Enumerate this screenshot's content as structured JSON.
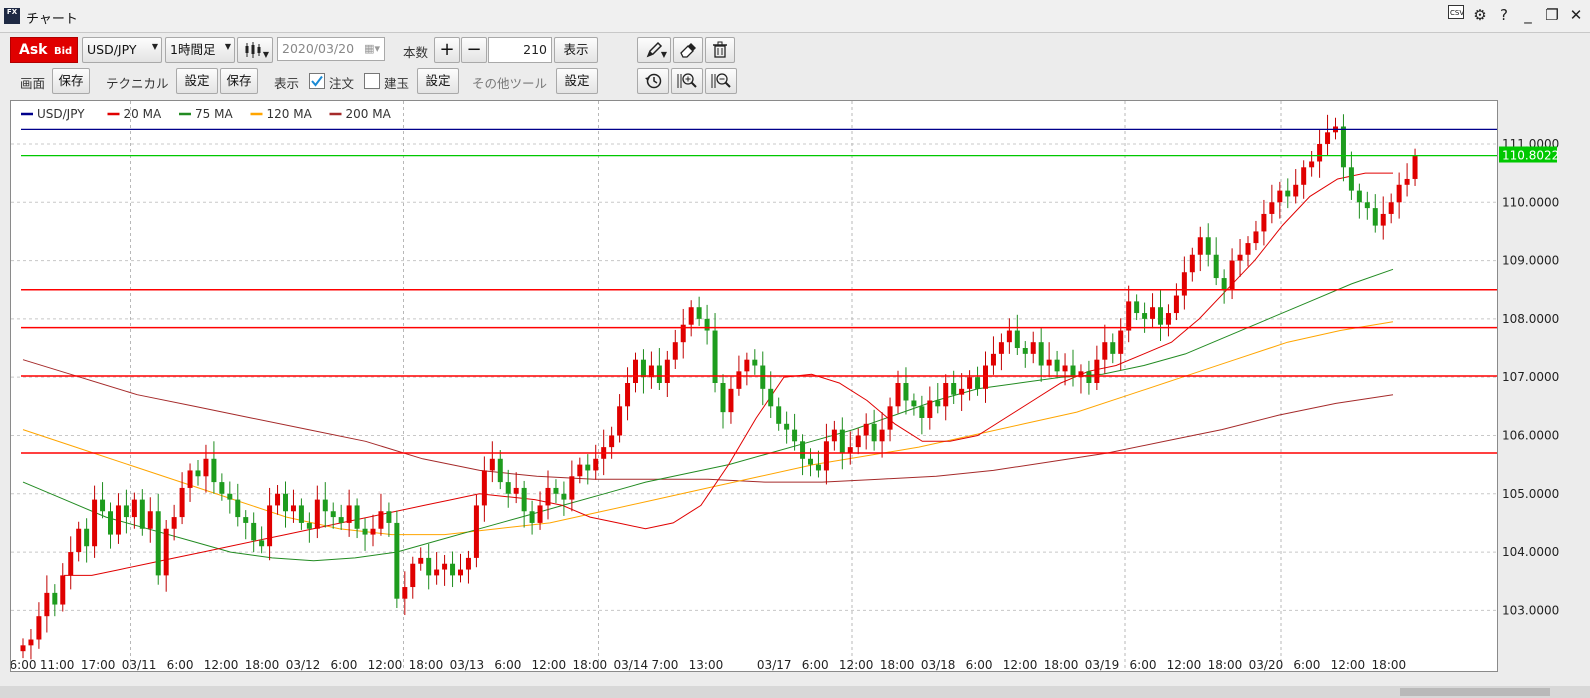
{
  "window": {
    "title": "チャート",
    "app_icon_text": "FX"
  },
  "toolbar": {
    "ask_label": "Ask",
    "bid_label": "Bid",
    "symbol": "USD/JPY",
    "timeframe": "1時間足",
    "date_value": "2020/03/20",
    "count_label": "本数",
    "count_value": "210",
    "show_button": "表示",
    "screen_label": "画面",
    "save_label": "保存",
    "technical_label": "テクニカル",
    "settings_label": "設定",
    "display_label": "表示",
    "order_label": "注文",
    "order_checked": true,
    "position_label": "建玉",
    "position_checked": false,
    "other_tools_label": "その他ツール"
  },
  "icons": {
    "pen": "pen-icon",
    "eraser": "eraser-icon",
    "trash": "trash-icon",
    "history": "history-icon",
    "zoom_in": "zoom-in-icon",
    "zoom_out": "zoom-out-icon",
    "csv": "csv-icon",
    "gear": "gear-icon",
    "help": "help-icon"
  },
  "colors": {
    "ask": "#e00000",
    "bull": "#e00000",
    "bear": "#1e9c1e",
    "last_price": "#00c800"
  },
  "chart_data": {
    "type": "candlestick",
    "legend": [
      {
        "name": "USD/JPY",
        "color": "#00008b"
      },
      {
        "name": "20 MA",
        "color": "#e00000"
      },
      {
        "name": "75 MA",
        "color": "#228b22"
      },
      {
        "name": "120 MA",
        "color": "#ffa500"
      },
      {
        "name": "200 MA",
        "color": "#a52a2a"
      }
    ],
    "ylim": [
      102.2,
      111.6
    ],
    "y_ticks": [
      103,
      104,
      105,
      106,
      107,
      108,
      109,
      110,
      111
    ],
    "y_tick_labels": [
      "103.0000",
      "104.0000",
      "105.0000",
      "106.0000",
      "107.0000",
      "108.0000",
      "109.0000",
      "110.0000",
      "111.0000"
    ],
    "last_price": 110.8022,
    "last_price_label": "110.8022",
    "n_bars": 152,
    "x_ticks": [
      {
        "bar": 0,
        "label": "6:00"
      },
      {
        "bar": 5,
        "label": "11:00"
      },
      {
        "bar": 11,
        "label": "17:00"
      },
      {
        "bar": 17,
        "label": "03/11"
      },
      {
        "bar": 23,
        "label": "6:00"
      },
      {
        "bar": 29,
        "label": "12:00"
      },
      {
        "bar": 35,
        "label": "18:00"
      },
      {
        "bar": 41,
        "label": "03/12"
      },
      {
        "bar": 47,
        "label": "6:00"
      },
      {
        "bar": 53,
        "label": "12:00"
      },
      {
        "bar": 59,
        "label": "18:00"
      },
      {
        "bar": 65,
        "label": "03/13"
      },
      {
        "bar": 71,
        "label": "6:00"
      },
      {
        "bar": 77,
        "label": "12:00"
      },
      {
        "bar": 83,
        "label": "18:00"
      },
      {
        "bar": 89,
        "label": "03/14"
      },
      {
        "bar": 94,
        "label": "7:00"
      },
      {
        "bar": 100,
        "label": "13:00"
      },
      {
        "bar": 110,
        "label": "03/17"
      },
      {
        "bar": 116,
        "label": "6:00"
      },
      {
        "bar": 122,
        "label": "12:00"
      },
      {
        "bar": 128,
        "label": "18:00"
      },
      {
        "bar": 134,
        "label": "03/18"
      },
      {
        "bar": 140,
        "label": "6:00"
      },
      {
        "bar": 146,
        "label": "12:00"
      },
      {
        "bar": 152,
        "label": "18:00"
      },
      {
        "bar": 158,
        "label": "03/19"
      },
      {
        "bar": 164,
        "label": "6:00"
      },
      {
        "bar": 170,
        "label": "12:00"
      },
      {
        "bar": 176,
        "label": "18:00"
      },
      {
        "bar": 182,
        "label": "03/20"
      },
      {
        "bar": 188,
        "label": "6:00"
      },
      {
        "bar": 194,
        "label": "12:00"
      },
      {
        "bar": 200,
        "label": "18:00"
      }
    ],
    "x_grid_bars": [
      17,
      59,
      89,
      128,
      170,
      194
    ],
    "horizontal_lines": [
      {
        "value": 111.25,
        "color": "#00008b"
      },
      {
        "value": 110.8,
        "color": "#00c800"
      },
      {
        "value": 108.5,
        "color": "#ff0000"
      },
      {
        "value": 107.85,
        "color": "#ff0000"
      },
      {
        "value": 107.02,
        "color": "#ff0000"
      },
      {
        "value": 105.7,
        "color": "#ff0000"
      }
    ],
    "closes": [
      102.4,
      102.5,
      102.9,
      103.3,
      103.1,
      103.6,
      104.0,
      104.4,
      104.1,
      104.9,
      104.7,
      104.3,
      104.8,
      104.6,
      104.9,
      104.4,
      104.7,
      103.6,
      104.4,
      104.6,
      105.1,
      105.4,
      105.3,
      105.6,
      105.2,
      105.0,
      104.9,
      104.6,
      104.5,
      104.2,
      104.1,
      104.8,
      105.0,
      104.7,
      104.8,
      104.5,
      104.4,
      104.9,
      104.7,
      104.6,
      104.5,
      104.8,
      104.4,
      104.3,
      104.4,
      104.7,
      104.5,
      103.2,
      103.4,
      103.8,
      103.9,
      103.6,
      103.7,
      103.8,
      103.6,
      103.7,
      103.9,
      104.8,
      105.4,
      105.6,
      105.2,
      105.0,
      105.1,
      104.7,
      104.5,
      104.8,
      105.1,
      105.0,
      104.9,
      105.3,
      105.5,
      105.4,
      105.6,
      105.8,
      106.0,
      106.5,
      106.9,
      107.3,
      107.0,
      107.2,
      106.9,
      107.3,
      107.6,
      107.9,
      108.2,
      108.0,
      107.8,
      106.9,
      106.4,
      106.8,
      107.1,
      107.3,
      107.2,
      106.8,
      106.5,
      106.2,
      106.1,
      105.9,
      105.6,
      105.5,
      105.4,
      105.9,
      106.1,
      105.7,
      105.8,
      106.0,
      106.2,
      105.9,
      106.1,
      106.5,
      106.9,
      106.6,
      106.5,
      106.3,
      106.6,
      106.5,
      106.9,
      106.7,
      106.8,
      107.0,
      106.8,
      107.2,
      107.4,
      107.6,
      107.8,
      107.5,
      107.4,
      107.6,
      107.2,
      107.3,
      107.1,
      107.2,
      107.0,
      107.1,
      106.9,
      107.3,
      107.6,
      107.4,
      107.8,
      108.3,
      108.1,
      108.0,
      108.2,
      107.9,
      108.1,
      108.4,
      108.8,
      109.1,
      109.4,
      109.1,
      108.7,
      108.5,
      109.0,
      109.1
    ],
    "closes_tail": [
      109.3,
      109.5,
      109.8,
      110.0,
      110.2,
      110.1,
      110.3,
      110.6,
      110.7,
      111.0,
      111.2,
      111.3,
      110.6,
      110.2,
      110.0,
      109.9,
      109.6,
      109.8,
      110.0,
      110.3,
      110.4,
      110.8
    ],
    "ma20": [
      103.6,
      103.6,
      103.7,
      103.8,
      103.9,
      104.0,
      104.1,
      104.2,
      104.3,
      104.4,
      104.5,
      104.6,
      104.7,
      104.8,
      104.9,
      105.0,
      104.95,
      104.9,
      104.8,
      104.6,
      104.5,
      104.4,
      104.5,
      104.8,
      105.5,
      106.3,
      107.0,
      107.05,
      106.9,
      106.6,
      106.2,
      105.9,
      105.9,
      106.0,
      106.3,
      106.6,
      106.9,
      107.1,
      107.2,
      107.4,
      107.6,
      108.0,
      108.5,
      109.0,
      109.6,
      110.1,
      110.4,
      110.5,
      110.5
    ],
    "ma75": [
      105.2,
      104.9,
      104.6,
      104.4,
      104.2,
      104.0,
      103.9,
      103.85,
      103.9,
      104.0,
      104.2,
      104.4,
      104.6,
      104.8,
      105.0,
      105.2,
      105.35,
      105.5,
      105.7,
      105.9,
      106.1,
      106.35,
      106.6,
      106.8,
      106.9,
      107.0,
      107.05,
      107.2,
      107.4,
      107.7,
      108.0,
      108.3,
      108.6,
      108.85
    ],
    "ma120": [
      106.1,
      105.8,
      105.5,
      105.2,
      104.9,
      104.6,
      104.4,
      104.3,
      104.3,
      104.4,
      104.5,
      104.7,
      104.9,
      105.1,
      105.3,
      105.5,
      105.65,
      105.8,
      106.0,
      106.2,
      106.4,
      106.7,
      107.0,
      107.3,
      107.6,
      107.8,
      107.95
    ],
    "ma200": [
      107.3,
      107.0,
      106.7,
      106.5,
      106.3,
      106.1,
      105.9,
      105.6,
      105.4,
      105.3,
      105.25,
      105.25,
      105.25,
      105.2,
      105.2,
      105.25,
      105.3,
      105.4,
      105.55,
      105.7,
      105.9,
      106.1,
      106.35,
      106.55,
      106.7
    ]
  }
}
